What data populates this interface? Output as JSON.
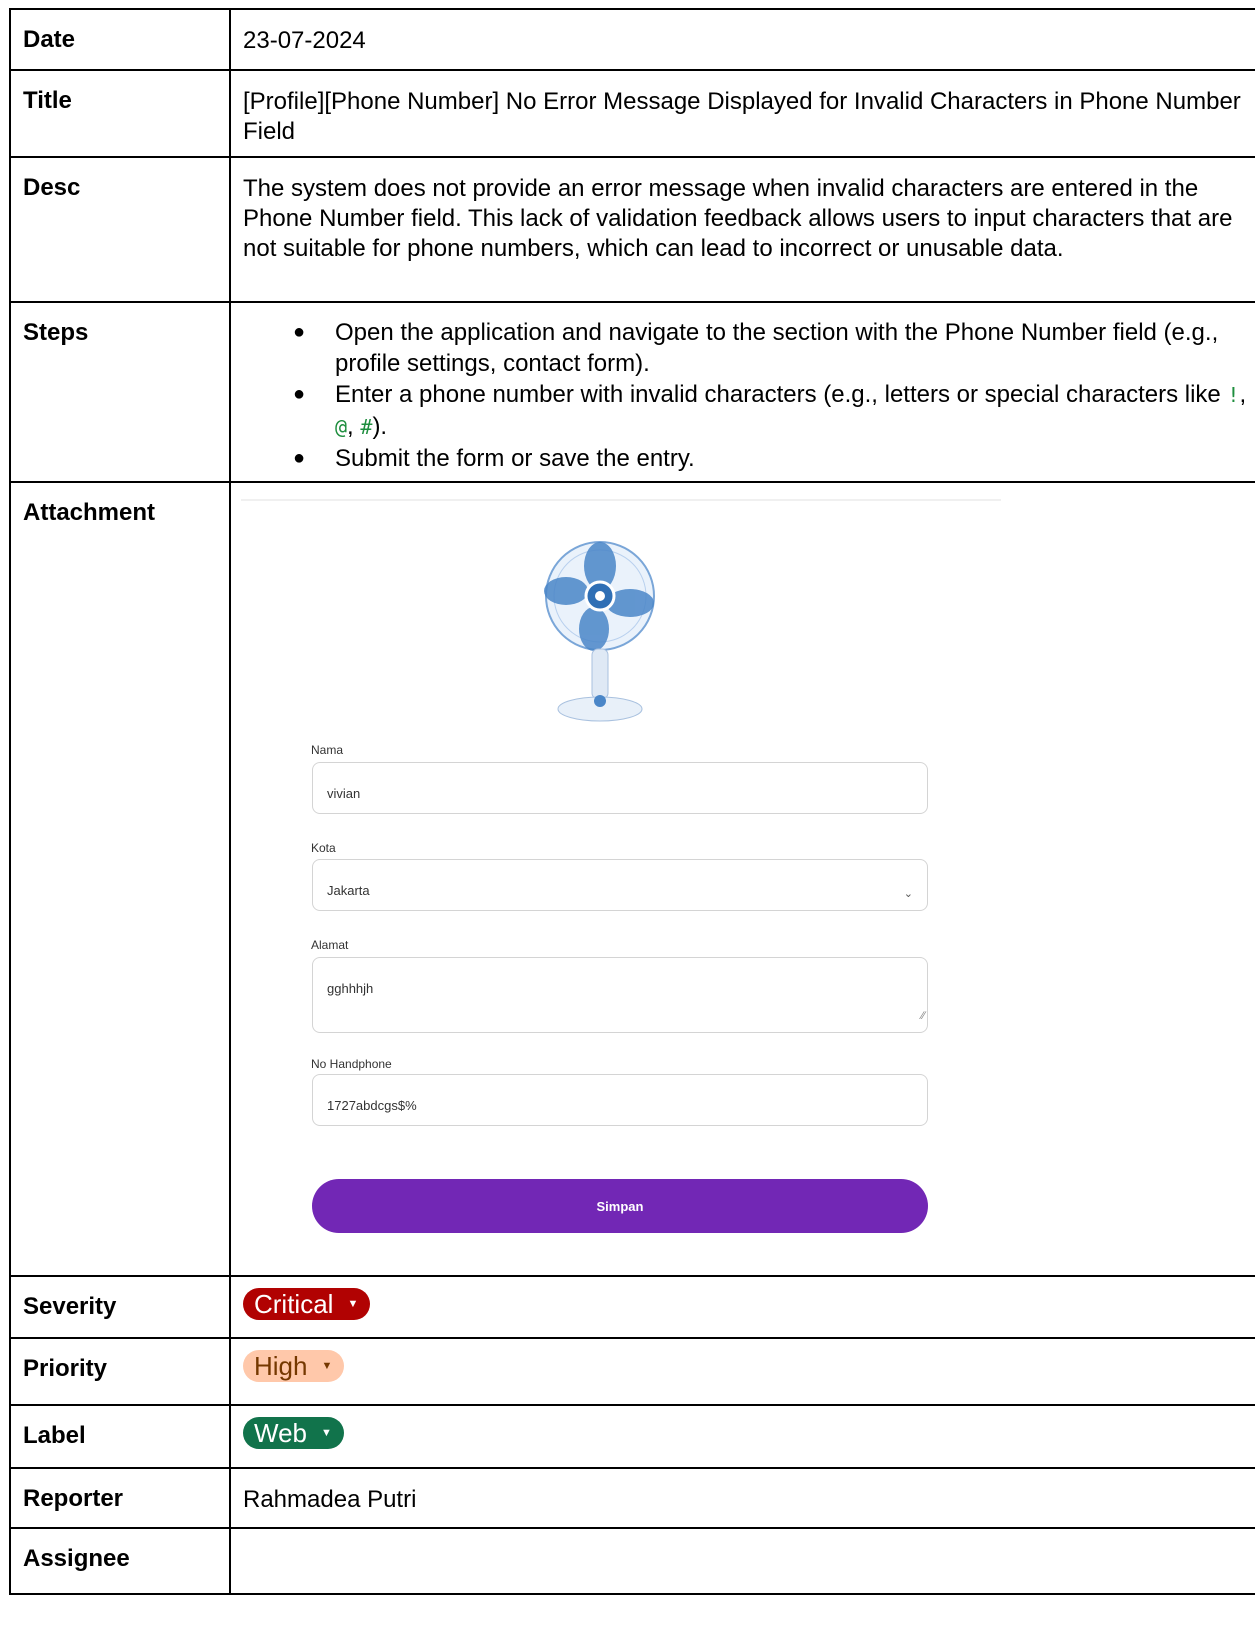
{
  "rows": {
    "date": {
      "key": "Date",
      "value": "23-07-2024"
    },
    "title": {
      "key": "Title",
      "value": "[Profile][Phone Number] No Error Message Displayed for Invalid Characters in Phone Number Field"
    },
    "desc": {
      "key": "Desc",
      "value": "The system does not provide an error message when invalid characters are entered in the Phone Number field. This lack of validation feedback allows users to input characters that are not suitable for phone numbers, which can lead to incorrect or unusable data."
    },
    "steps": {
      "key": "Steps",
      "bullet": "●",
      "items": [
        "Open the application and navigate to the section with the Phone Number field (e.g., profile settings, contact form).",
        "Enter a phone number with invalid characters (e.g., letters or special characters like ",
        "Submit the form or save the entry."
      ],
      "special_chars": [
        "!",
        "@",
        "#"
      ],
      "special_sep": ", ",
      "special_tail": ")."
    },
    "attachment": {
      "key": "Attachment"
    },
    "severity": {
      "key": "Severity",
      "value": "Critical"
    },
    "priority": {
      "key": "Priority",
      "value": "High"
    },
    "label": {
      "key": "Label",
      "value": "Web"
    },
    "reporter": {
      "key": "Reporter",
      "value": "Rahmadea Putri"
    },
    "assignee": {
      "key": "Assignee",
      "value": ""
    }
  },
  "attachment_form": {
    "nama_label": "Nama",
    "nama_value": "vivian",
    "kota_label": "Kota",
    "kota_value": "Jakarta",
    "alamat_label": "Alamat",
    "alamat_value": "gghhhjh",
    "hp_label": "No Handphone",
    "hp_value": "1727abdcgs$%",
    "button_label": "Simpan",
    "button_color": "#7227b5"
  },
  "colors": {
    "critical": "#b10202",
    "high": "#ffc8aa",
    "web": "#11734b"
  }
}
